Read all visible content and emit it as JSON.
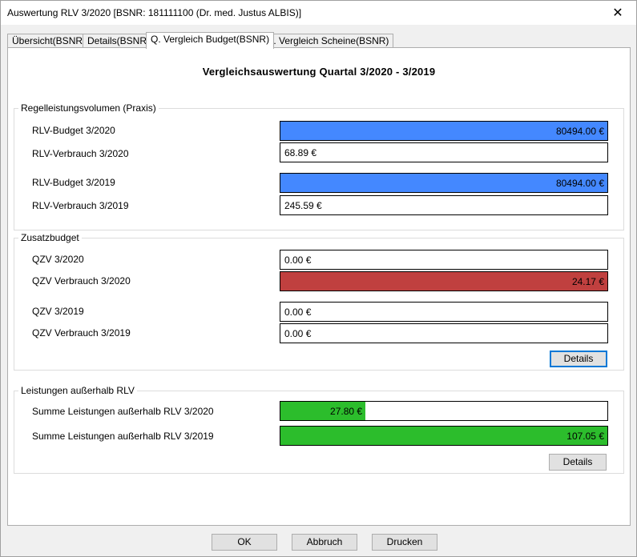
{
  "window": {
    "title": "Auswertung RLV 3/2020 [BSNR: 181111100 (Dr. med. Justus ALBIS)]",
    "close_glyph": "✕"
  },
  "tabs": [
    {
      "label": "Übersicht(BSNR)",
      "active": false
    },
    {
      "label": "Details(BSNR)",
      "active": false
    },
    {
      "label": "Q. Vergleich Budget(BSNR)",
      "active": true
    },
    {
      "label": "Q. Vergleich Scheine(BSNR)",
      "active": false
    }
  ],
  "heading": "Vergleichsauswertung Quartal 3/2020 - 3/2019",
  "colors": {
    "blue_bar": "#4488ff",
    "red_bar": "#c0403f",
    "green_bar": "#2cbd2c"
  },
  "rlv": {
    "legend": "Regelleistungsvolumen (Praxis)",
    "rows": [
      {
        "label": "RLV-Budget 3/2020",
        "value": "80494.00 €",
        "fill": 1.0,
        "color": "blue"
      },
      {
        "label": "RLV-Verbrauch 3/2020",
        "value": "68.89 €",
        "fill": 0,
        "color": "none"
      },
      {
        "label": "RLV-Budget 3/2019",
        "value": "80494.00 €",
        "fill": 1.0,
        "color": "blue"
      },
      {
        "label": "RLV-Verbrauch 3/2019",
        "value": "245.59 €",
        "fill": 0,
        "color": "none"
      }
    ]
  },
  "zusatz": {
    "legend": "Zusatzbudget",
    "rows": [
      {
        "label": "QZV 3/2020",
        "value": "0.00 €",
        "fill": 0,
        "color": "none"
      },
      {
        "label": "QZV Verbrauch 3/2020",
        "value": "24.17 €",
        "fill": 1.0,
        "color": "red"
      },
      {
        "label": "QZV 3/2019",
        "value": "0.00 €",
        "fill": 0,
        "color": "none"
      },
      {
        "label": "QZV Verbrauch 3/2019",
        "value": "0.00 €",
        "fill": 0,
        "color": "none"
      }
    ],
    "details_label": "Details"
  },
  "ausserhalb": {
    "legend": "Leistungen außerhalb RLV",
    "rows": [
      {
        "label": "Summe Leistungen außerhalb RLV 3/2020",
        "value": "27.80 €",
        "fill": 0.26,
        "color": "green"
      },
      {
        "label": "Summe Leistungen außerhalb RLV 3/2019",
        "value": "107.05 €",
        "fill": 1.0,
        "color": "green"
      }
    ],
    "details_label": "Details"
  },
  "footer": {
    "ok_label": "OK",
    "cancel_label": "Abbruch",
    "print_label": "Drucken"
  }
}
